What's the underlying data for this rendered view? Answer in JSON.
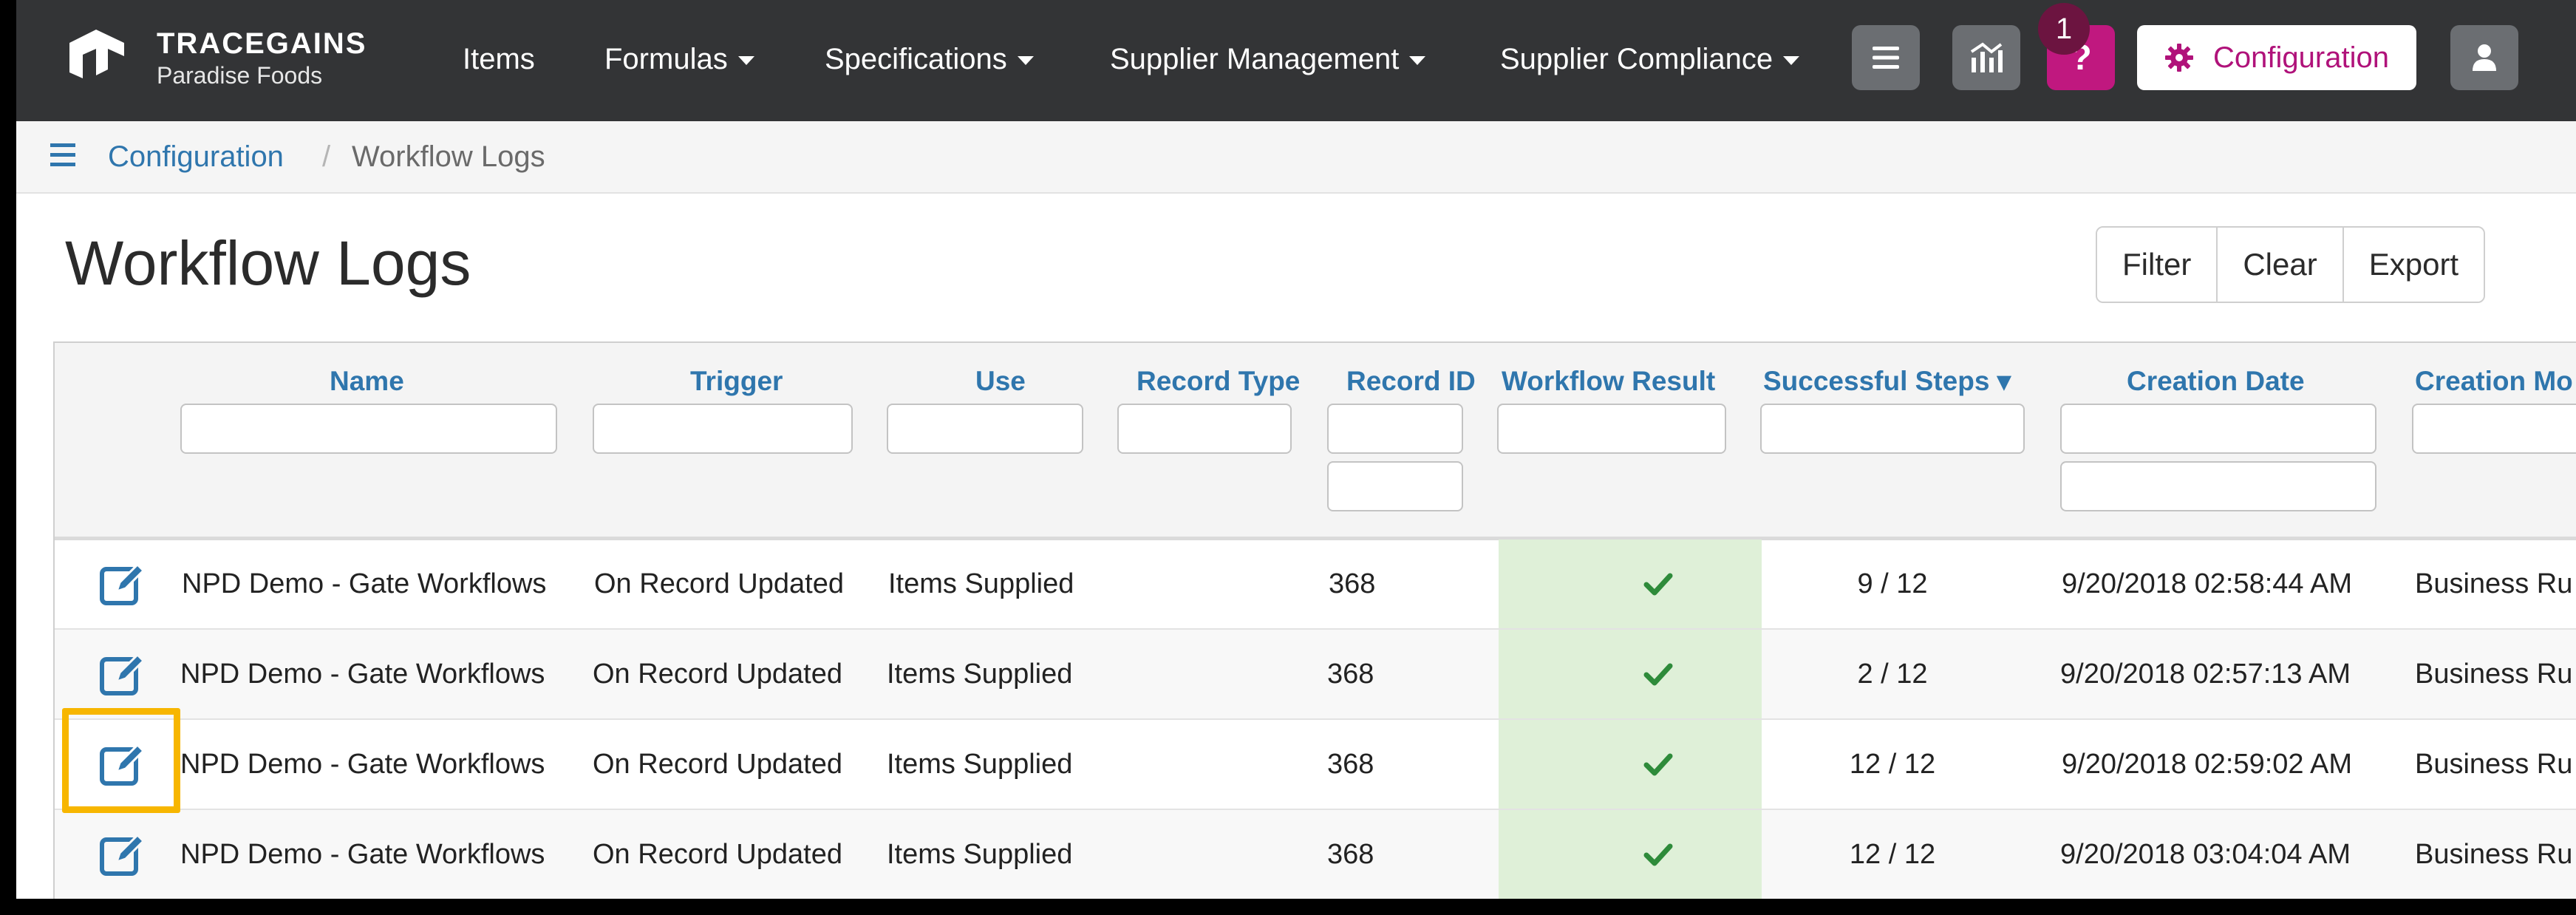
{
  "brand": {
    "name": "TRACEGAINS",
    "org": "Paradise Foods"
  },
  "nav": {
    "items": [
      {
        "label": "Items",
        "dropdown": false
      },
      {
        "label": "Formulas",
        "dropdown": true
      },
      {
        "label": "Specifications",
        "dropdown": true
      },
      {
        "label": "Supplier Management",
        "dropdown": true
      },
      {
        "label": "Supplier Compliance",
        "dropdown": true
      }
    ],
    "notification_count": "1",
    "help_label": "?",
    "config_label": "Configuration",
    "icons": [
      "hamburger-icon",
      "chart-icon",
      "question-icon",
      "gear-icon",
      "user-icon"
    ]
  },
  "breadcrumb": {
    "parent": "Configuration",
    "separator": "/",
    "current": "Workflow Logs"
  },
  "page": {
    "title": "Workflow Logs"
  },
  "actions": {
    "filter": "Filter",
    "clear": "Clear",
    "export": "Export"
  },
  "table": {
    "columns": [
      "Name",
      "Trigger",
      "Use",
      "Record Type",
      "Record ID",
      "Workflow Result",
      "Successful Steps ▾",
      "Creation Date",
      "Creation Mo"
    ],
    "rows": [
      {
        "name": "NPD Demo - Gate Workflows",
        "trigger": "On Record Updated",
        "use": "Items Supplied",
        "record_type": "",
        "record_id": "368",
        "result": "success",
        "steps": "9 / 12",
        "date": "9/20/2018 02:58:44 AM",
        "method": "Business Ru"
      },
      {
        "name": "NPD Demo - Gate Workflows",
        "trigger": "On Record Updated",
        "use": "Items Supplied",
        "record_type": "",
        "record_id": "368",
        "result": "success",
        "steps": "2 / 12",
        "date": "9/20/2018 02:57:13 AM",
        "method": "Business Ru"
      },
      {
        "name": "NPD Demo - Gate Workflows",
        "trigger": "On Record Updated",
        "use": "Items Supplied",
        "record_type": "",
        "record_id": "368",
        "result": "success",
        "steps": "12 / 12",
        "date": "9/20/2018 02:59:02 AM",
        "method": "Business Ru"
      },
      {
        "name": "NPD Demo - Gate Workflows",
        "trigger": "On Record Updated",
        "use": "Items Supplied",
        "record_type": "",
        "record_id": "368",
        "result": "success",
        "steps": "12 / 12",
        "date": "9/20/2018 03:04:04 AM",
        "method": "Business Ru"
      }
    ]
  },
  "colors": {
    "nav_bg": "#333436",
    "accent": "#b0127a",
    "link": "#2f76ad",
    "success_bg": "#dff0d8",
    "success": "#2e8b3a",
    "highlight": "#f7b600"
  }
}
